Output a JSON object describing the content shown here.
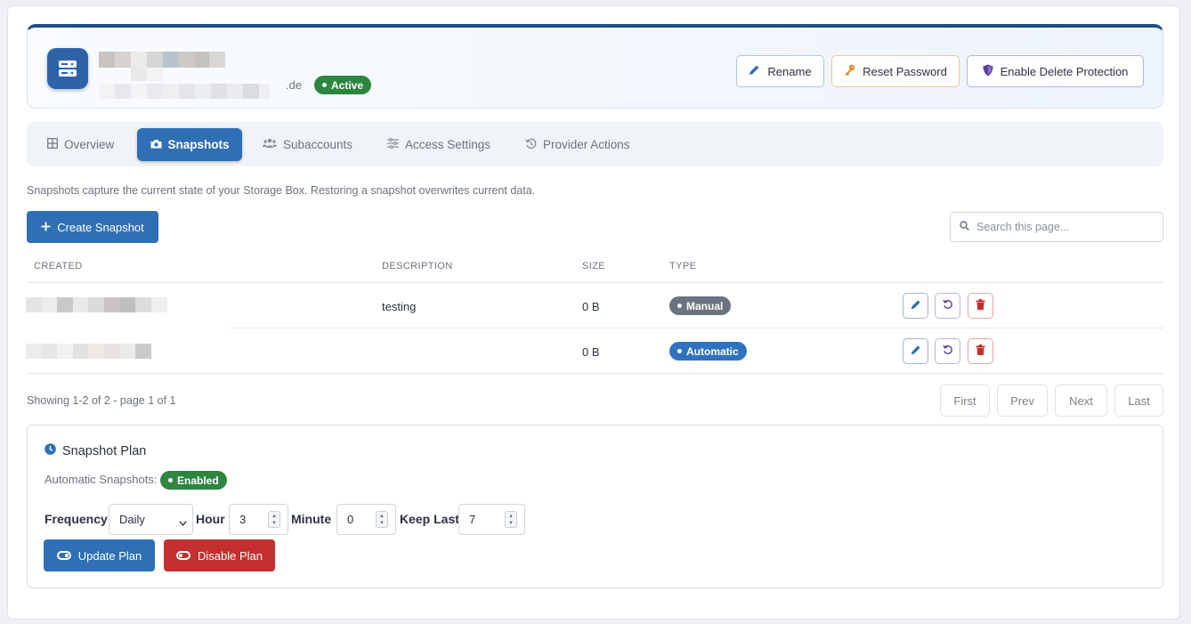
{
  "header": {
    "domain_suffix": ".de",
    "status": "Active",
    "buttons": {
      "rename": "Rename",
      "reset_password": "Reset Password",
      "delete_protection": "Enable Delete Protection"
    }
  },
  "tabs": [
    {
      "label": "Overview",
      "icon": "grid-icon"
    },
    {
      "label": "Snapshots",
      "icon": "camera-icon",
      "active": true
    },
    {
      "label": "Subaccounts",
      "icon": "users-icon"
    },
    {
      "label": "Access Settings",
      "icon": "sliders-icon"
    },
    {
      "label": "Provider Actions",
      "icon": "history-icon"
    }
  ],
  "intro": "Snapshots capture the current state of your Storage Box. Restoring a snapshot overwrites current data.",
  "toolbar": {
    "create_label": "Create Snapshot",
    "search_placeholder": "Search this page..."
  },
  "table": {
    "columns": [
      "CREATED",
      "DESCRIPTION",
      "SIZE",
      "TYPE"
    ],
    "rows": [
      {
        "created": "",
        "description": "testing",
        "size": "0 B",
        "type": "Manual"
      },
      {
        "created": "",
        "description": "",
        "size": "0 B",
        "type": "Automatic"
      }
    ]
  },
  "pagination": {
    "summary": "Showing 1-2 of 2 - page 1 of 1",
    "first": "First",
    "prev": "Prev",
    "next": "Next",
    "last": "Last"
  },
  "plan": {
    "title": "Snapshot Plan",
    "auto_label": "Automatic Snapshots:",
    "auto_status": "Enabled",
    "frequency_label": "Frequency",
    "frequency_value": "Daily",
    "hour_label": "Hour",
    "hour_value": "3",
    "minute_label": "Minute",
    "minute_value": "0",
    "keep_label": "Keep Last",
    "keep_value": "7",
    "update_label": "Update Plan",
    "disable_label": "Disable Plan"
  },
  "colors": {
    "primary": "#2f6fb6",
    "danger": "#c62f2f",
    "success": "#2e8540",
    "muted_badge": "#6b7280"
  }
}
